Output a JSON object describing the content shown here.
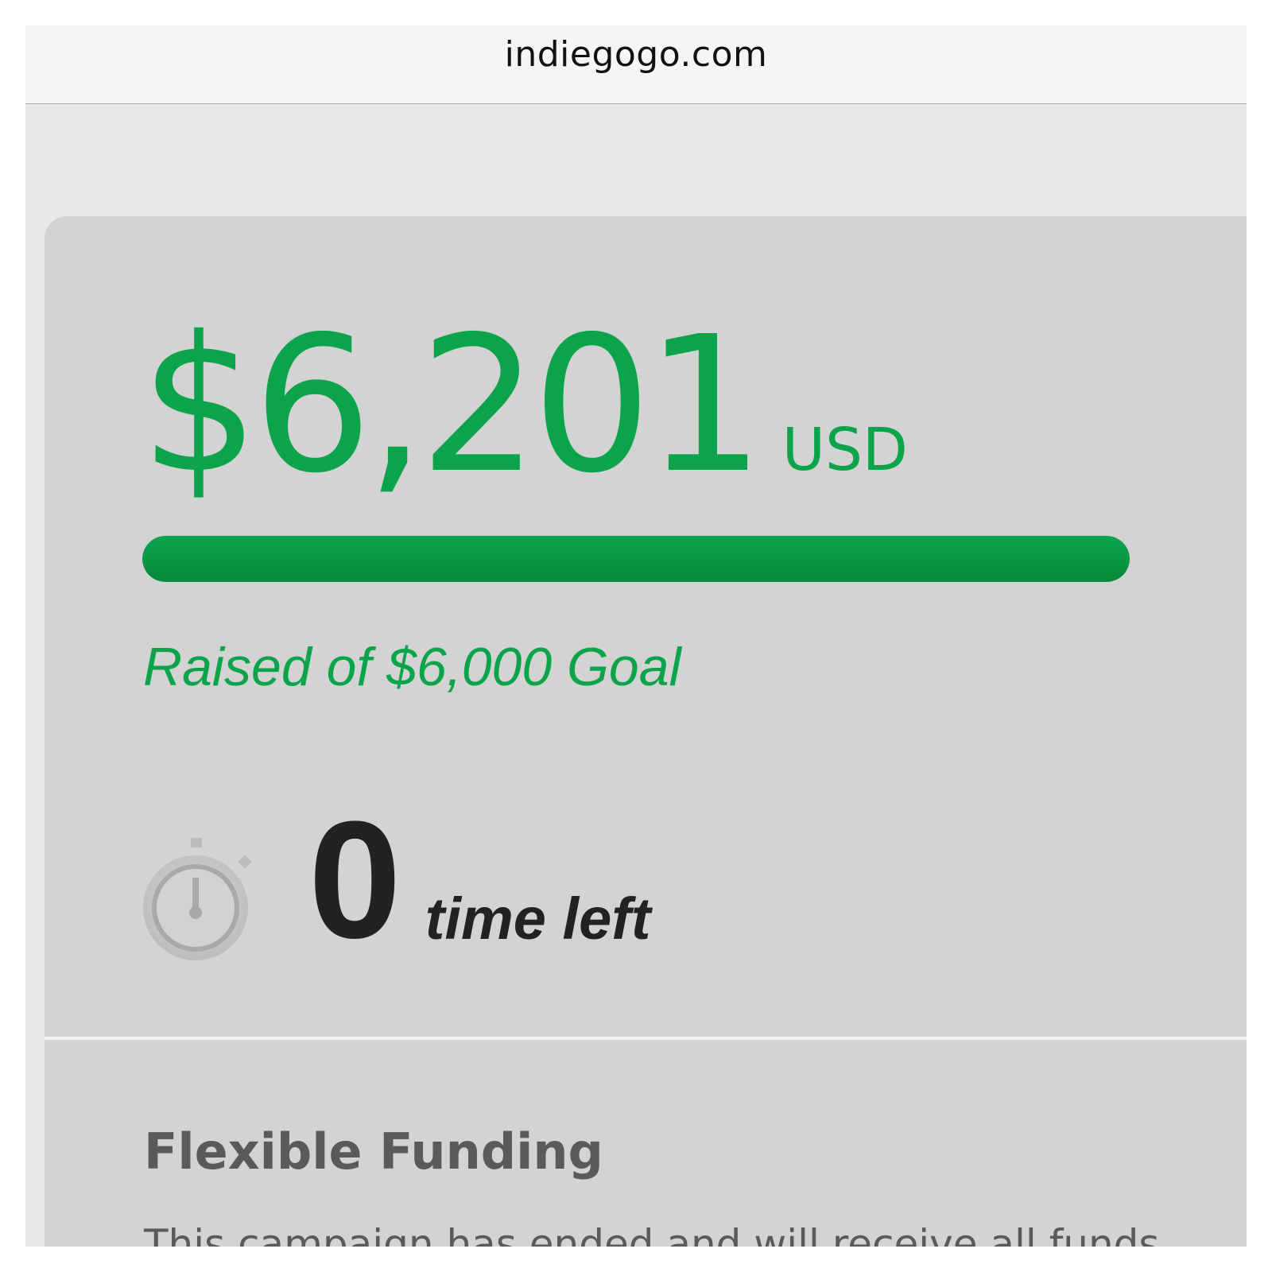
{
  "browser": {
    "url": "indiegogo.com"
  },
  "campaign": {
    "amount_raised": "$6,201",
    "currency": "USD",
    "progress_percent": 100,
    "raised_text": "Raised of $6,000 Goal",
    "time_left_value": "0",
    "time_left_label": "time left",
    "icons": {
      "timer": "stopwatch-icon"
    },
    "colors": {
      "accent": "#0ca44a",
      "progress": "#0a9b45"
    }
  },
  "funding": {
    "title": "Flexible Funding",
    "description": "This campaign has ended and will receive all funds"
  }
}
